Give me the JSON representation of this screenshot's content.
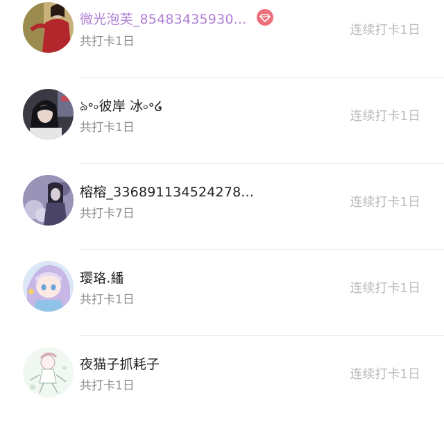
{
  "rows": [
    {
      "name": "微光泡芙_85483435930...",
      "subtitle": "共打卡1日",
      "streak": "连续打卡1日",
      "vip": true,
      "avatar_color": "#b3262c"
    },
    {
      "name": "ঌ॰৹彼岸 冰৹॰໒",
      "subtitle": "共打卡1日",
      "streak": "连续打卡1日",
      "vip": false,
      "avatar_color": "#2b2b33"
    },
    {
      "name": "榕榕_336891134524278...",
      "subtitle": "共打卡7日",
      "streak": "连续打卡1日",
      "vip": false,
      "avatar_color": "#8e86ad"
    },
    {
      "name": "璎珞.繙",
      "subtitle": "共打卡1日",
      "streak": "连续打卡1日",
      "vip": false,
      "avatar_color": "#c9d8ee"
    },
    {
      "name": "夜猫子抓耗子",
      "subtitle": "共打卡1日",
      "streak": "连续打卡1日",
      "vip": false,
      "avatar_color": "#eef5ee"
    }
  ],
  "badge_icon": "diamond-icon",
  "colors": {
    "vip_name": "#b07fd4",
    "badge": "#ee6f7c",
    "streak": "#b9b9b9",
    "subtitle": "#8a8a8a"
  }
}
